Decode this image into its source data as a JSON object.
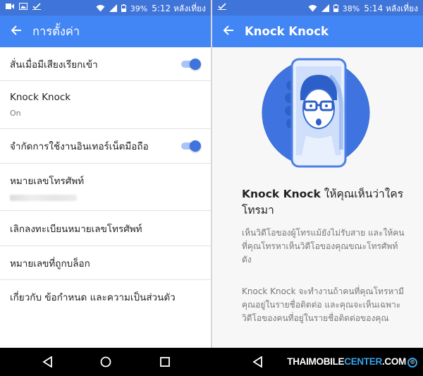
{
  "left": {
    "status": {
      "battery": "39%",
      "time": "5:12 หลังเที่ยง"
    },
    "title": "การตั้งค่า",
    "settings": [
      {
        "label": "สั่นเมื่อมีเสียงเรียกเข้า",
        "toggle": true
      },
      {
        "label": "Knock Knock",
        "sub": "On"
      },
      {
        "label": "จำกัดการใช้งานอินเทอร์เน็ตมือถือ",
        "toggle": true
      },
      {
        "label": "หมายเลขโทรศัพท์"
      },
      {
        "label": "เลิกลงทะเบียนหมายเลขโทรศัพท์"
      },
      {
        "label": "หมายเลขที่ถูกบล็อก"
      },
      {
        "label": "เกี่ยวกับ ข้อกำหนด และความเป็นส่วนตัว"
      }
    ]
  },
  "right": {
    "status": {
      "battery": "38%",
      "time": "5:14 หลังเที่ยง"
    },
    "title": "Knock Knock",
    "heading_bold": "Knock Knock",
    "heading_rest": " ให้คุณเห็นว่าใครโทรมา",
    "para1": "เห็นวิดีโอของผู้โทรแม้ยังไม่รับสาย และให้คนที่คุณโทรหาเห็นวิดีโอของคุณขณะโทรศัพท์ดัง",
    "para2": "Knock Knock จะทำงานถ้าคนที่คุณโทรหามีคุณอยู่ในรายชื่อติดต่อ และคุณจะเห็นเฉพาะวิดีโอของคนที่อยู่ในรายชื่อติดต่อของคุณ"
  },
  "watermark": {
    "part1": "THAIMOBILE",
    "part2": "CENTER",
    "part3": ".COM"
  },
  "colors": {
    "appbar": "#4285f4",
    "statusbar": "#3f74d8",
    "accent": "#3f74e0"
  }
}
